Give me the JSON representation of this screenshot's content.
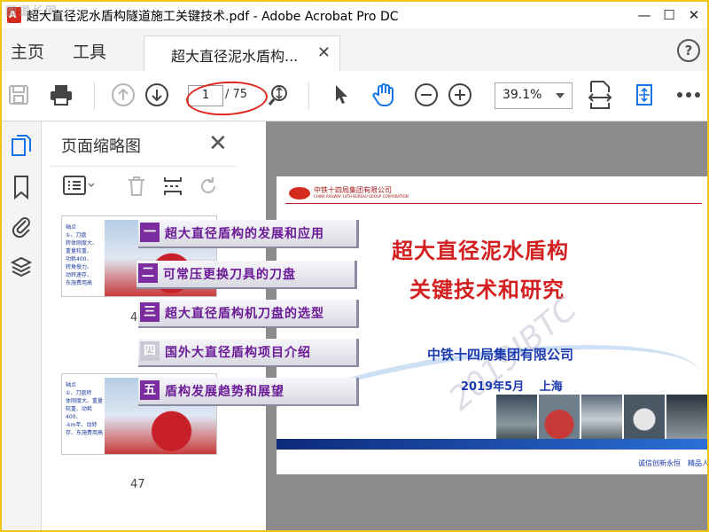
{
  "window": {
    "title": "超大直径泥水盾构隧道施工关键技术.pdf - Adobe Acrobat Pro DC",
    "watermark": "图道长网"
  },
  "tabs": {
    "home": "主页",
    "tools": "工具",
    "doc_tab": "超大直径泥水盾构..."
  },
  "toolbar": {
    "current_page": "1",
    "total_pages": "/ 75",
    "zoom": "39.1%"
  },
  "panel": {
    "title": "页面缩略图",
    "thumbnails": [
      {
        "page": "46",
        "snippet": "轴点\n①、刀盘\n转体刚度大、\n重量较重、\n功耗400、\n转角慢力、\n动转速存、\n东施费用高"
      },
      {
        "page": "47",
        "snippet": "轴点\n①、刀盘转\n体刚度大、重量\n较重、动耗400、\n-km年、动转\n存、东施费用高"
      }
    ]
  },
  "slide": {
    "company_cn": "中铁十四局集团有限公司",
    "company_en": "CHINA RAILWAY 14TH BUREAU GROUP CORPORATION",
    "title_line1": "超大直径泥水盾构",
    "title_line2": "关键技术和研究",
    "org": "中铁十四局集团有限公司",
    "date_place": "2019年5月　 上海",
    "watermark": "2019IBTC",
    "motto": "诚信创新永恒　精品人"
  },
  "overlay_menu": [
    {
      "num": "一",
      "text": "超大直径盾构的发展和应用"
    },
    {
      "num": "二",
      "text": "可常压更换刀具的刀盘"
    },
    {
      "num": "三",
      "text": "超大直径盾构机刀盘的选型"
    },
    {
      "num": "四",
      "text": "国外大直径盾构项目介绍"
    },
    {
      "num": "五",
      "text": "盾构发展趋势和展望"
    }
  ],
  "colors": {
    "accent_red": "#d31f1f",
    "accent_blue": "#1c3bb0",
    "overlay_purple": "#6b1b96",
    "annotation_red": "#e0241b"
  }
}
